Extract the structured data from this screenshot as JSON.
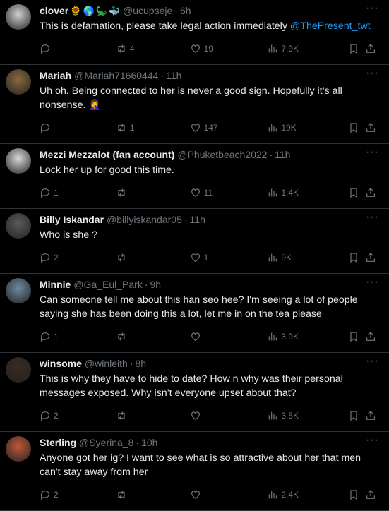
{
  "tweets": [
    {
      "name": "clover",
      "emojis": [
        "🌻",
        "🌎",
        "🦕",
        "🐳"
      ],
      "handle": "@ucupseje",
      "time": "6h",
      "text": "This is defamation, please take legal action immediately ",
      "mention": "@ThePresent_twt",
      "replies": "",
      "retweets": "4",
      "likes": "19",
      "views": "7.9K",
      "avatar_color": "#cfcfcf"
    },
    {
      "name": "Mariah",
      "handle": "@Mariah71660444",
      "time": "11h",
      "text": "Uh oh. Being connected to her is never a good sign. Hopefully it’s all nonsense. 🤦‍♀️",
      "replies": "",
      "retweets": "1",
      "likes": "147",
      "views": "19K",
      "avatar_color": "#8a6a3e"
    },
    {
      "name": "Mezzi Mezzalot (fan account)",
      "handle": "@Phuketbeach2022",
      "time": "11h",
      "text": "Lock her up for good this time.",
      "replies": "1",
      "retweets": "",
      "likes": "11",
      "views": "1.4K",
      "avatar_color": "#d8d8d8"
    },
    {
      "name": "Billy Iskandar",
      "handle": "@billyiskandar05",
      "time": "11h",
      "text": "Who is she ?",
      "replies": "2",
      "retweets": "",
      "likes": "1",
      "views": "9K",
      "avatar_color": "#5a5a5a"
    },
    {
      "name": "Minnie",
      "handle": "@Ga_Eul_Park",
      "time": "9h",
      "text": "Can someone tell me about this han seo hee? I'm seeing a lot of people saying she has been doing this a lot, let me in on the tea please",
      "replies": "1",
      "retweets": "",
      "likes": "",
      "views": "3.9K",
      "avatar_color": "#6e8aa0"
    },
    {
      "name": "winsome",
      "handle": "@winleith",
      "time": "8h",
      "text": "This is why they have to hide to date?  How n why was their personal messages exposed.  Why isn’t everyone upset about that?",
      "replies": "2",
      "retweets": "",
      "likes": "",
      "views": "3.5K",
      "avatar_color": "#3a2a22"
    },
    {
      "name": "Sterling",
      "handle": "@Syerina_8",
      "time": "10h",
      "text": "Anyone got her ig? I want to see what is so attractive about her that men can't stay away from her",
      "replies": "2",
      "retweets": "",
      "likes": "",
      "views": "2.4K",
      "avatar_color": "#c0583a"
    }
  ],
  "colors": {
    "background": "#000000",
    "text": "#e7e9ea",
    "muted": "#71767b",
    "link": "#1d9bf0",
    "divider": "#2f3336"
  },
  "icons": [
    "reply-icon",
    "retweet-icon",
    "like-icon",
    "views-icon",
    "bookmark-icon",
    "share-icon",
    "more-icon"
  ]
}
